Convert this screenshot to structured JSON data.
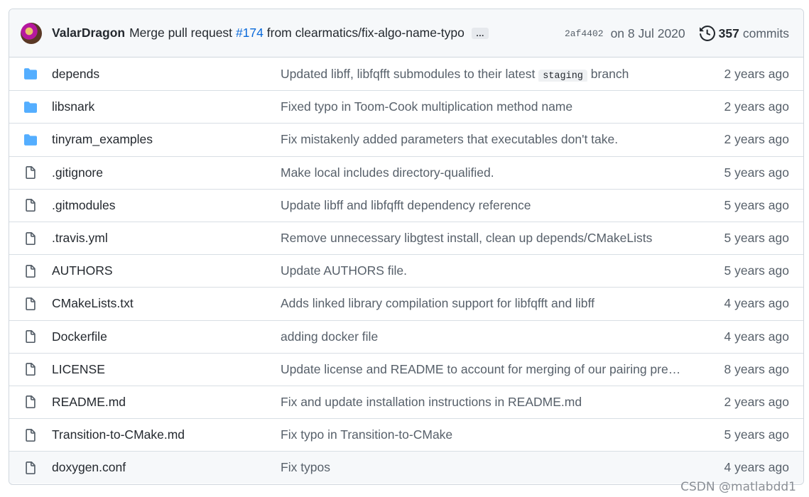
{
  "commit": {
    "author": "ValarDragon",
    "message_prefix": "Merge pull request",
    "pr_link": "#174",
    "message_suffix": "from clearmatics/fix-algo-name-typo",
    "ellipsis": "…",
    "sha": "2af4402",
    "date": "on 8 Jul 2020",
    "commit_count": "357",
    "commits_label": "commits"
  },
  "files": [
    {
      "type": "folder",
      "name": "depends",
      "message_before": "Updated libff, libfqfft submodules to their latest",
      "message_code": "staging",
      "message_after": "branch",
      "age": "2 years ago"
    },
    {
      "type": "folder",
      "name": "libsnark",
      "message": "Fixed typo in Toom-Cook multiplication method name",
      "age": "2 years ago"
    },
    {
      "type": "folder",
      "name": "tinyram_examples",
      "message": "Fix mistakenly added parameters that executables don't take.",
      "age": "2 years ago"
    },
    {
      "type": "file",
      "name": ".gitignore",
      "message": "Make local includes directory-qualified.",
      "age": "5 years ago"
    },
    {
      "type": "file",
      "name": ".gitmodules",
      "message": "Update libff and libfqfft dependency reference",
      "age": "5 years ago"
    },
    {
      "type": "file",
      "name": ".travis.yml",
      "message": "Remove unnecessary libgtest install, clean up depends/CMakeLists",
      "age": "5 years ago"
    },
    {
      "type": "file",
      "name": "AUTHORS",
      "message": "Update AUTHORS file.",
      "age": "5 years ago"
    },
    {
      "type": "file",
      "name": "CMakeLists.txt",
      "message": "Adds linked library compilation support for libfqfft and libff",
      "age": "4 years ago"
    },
    {
      "type": "file",
      "name": "Dockerfile",
      "message": "adding docker file",
      "age": "4 years ago"
    },
    {
      "type": "file",
      "name": "LICENSE",
      "message": "Update license and README to account for merging of our pairing prec…",
      "age": "8 years ago"
    },
    {
      "type": "file",
      "name": "README.md",
      "message": "Fix and update installation instructions in README.md",
      "age": "2 years ago"
    },
    {
      "type": "file",
      "name": "Transition-to-CMake.md",
      "message": "Fix typo in Transition-to-CMake",
      "age": "5 years ago"
    },
    {
      "type": "file",
      "name": "doxygen.conf",
      "message": "Fix typos",
      "age": "4 years ago"
    }
  ],
  "colors": {
    "folder": "#54aeff",
    "file_icon": "#57606a",
    "link": "#0969da"
  },
  "icons": {
    "folder": "folder-icon",
    "file": "file-icon",
    "history": "history-icon"
  },
  "watermark": "CSDN @matlabdd1"
}
